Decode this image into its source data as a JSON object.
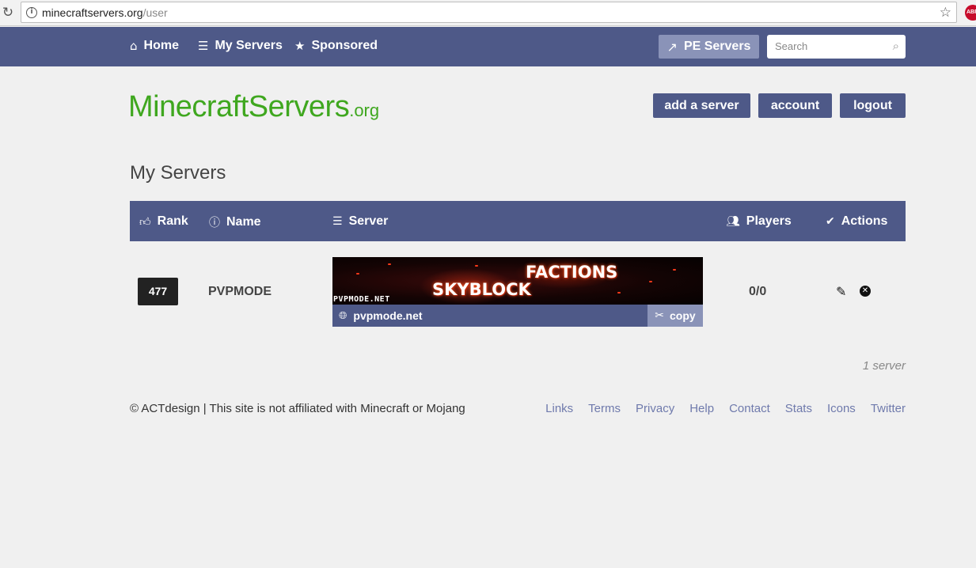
{
  "browser": {
    "url_host": "minecraftservers.org",
    "url_path": "/user",
    "abp_label": "ABP"
  },
  "nav": {
    "home": "Home",
    "my_servers": "My Servers",
    "sponsored": "Sponsored",
    "pe_servers": "PE Servers",
    "search_placeholder": "Search"
  },
  "logo": {
    "main": "MinecraftServers",
    "tld": ".org"
  },
  "actions": {
    "add_server": "add a server",
    "account": "account",
    "logout": "logout"
  },
  "page_title": "My Servers",
  "table": {
    "headers": {
      "rank": "Rank",
      "name": "Name",
      "server": "Server",
      "players": "Players",
      "actions": "Actions"
    },
    "rows": [
      {
        "rank": "477",
        "name": "PVPMODE",
        "banner_line1": "FACTIONS",
        "banner_line2": "SKYBLOCK",
        "banner_site": "PVPMODE.NET",
        "address": "pvpmode.net",
        "copy_label": "copy",
        "players": "0/0"
      }
    ],
    "count": "1 server"
  },
  "footer": {
    "copyright": "© ACTdesign | This site is not affiliated with Minecraft or Mojang",
    "links": [
      "Links",
      "Terms",
      "Privacy",
      "Help",
      "Contact",
      "Stats",
      "Icons",
      "Twitter"
    ]
  },
  "colors": {
    "nav_bg": "#4e5988",
    "accent_light": "#8a93b8",
    "logo_green": "#3fa71f",
    "link": "#6f7aac",
    "page_bg": "#f0f0f0"
  }
}
